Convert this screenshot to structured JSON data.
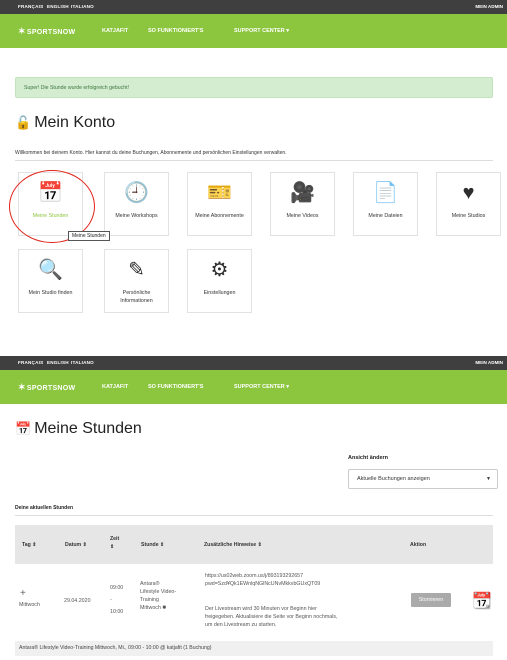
{
  "top_lang": [
    "FRANÇAIS",
    "ENGLISH",
    "ITALIANO"
  ],
  "admin": "MEIN ADMIN",
  "brand": "SPORTSNOW",
  "nav": [
    "KATJAFIT",
    "SO FUNKTIONIERT'S",
    "SUPPORT CENTER ▾"
  ],
  "colors": {
    "accent_green": "#8cc63f",
    "dark_bar": "#3f3f3f",
    "highlight_red": "#e2231a"
  },
  "account": {
    "success_message": "Super! Die Stunde wurde erfolgreich gebucht!",
    "title": "Mein Konto",
    "welcome": "Willkommen bei deinem Konto. Hier kannst du deine Buchungen, Abonnemente und persönlichen Einstellungen verwalten.",
    "tiles": [
      {
        "label": "Meine Stunden",
        "icon": "calendar-icon"
      },
      {
        "label": "Meine Workshops",
        "icon": "clock-icon"
      },
      {
        "label": "Meine Abonnemente",
        "icon": "ticket-icon"
      },
      {
        "label": "Meine Videos",
        "icon": "video-camera-icon"
      },
      {
        "label": "Meine Dateien",
        "icon": "document-icon"
      },
      {
        "label": "Meine Studios",
        "icon": "heart-icon"
      },
      {
        "label": "Mein Studio finden",
        "icon": "search-icon"
      },
      {
        "label": "Persönliche Informationen",
        "icon": "edit-icon"
      },
      {
        "label": "Einstellungen",
        "icon": "gear-icon"
      }
    ],
    "tooltip": "Meine Stunden"
  },
  "lessons": {
    "title": "Meine Stunden",
    "view_label": "Ansicht ändern",
    "view_value": "Aktuelle Buchungen anzeigen",
    "current_label": "Deine aktuellen Stunden",
    "headers": [
      "Tag ⇕",
      "Datum ⇕",
      "Zeit ⇕",
      "Stunde ⇕",
      "Zusätzliche Hinweise ⇕",
      "Aktion"
    ],
    "row": {
      "day": "Mittwoch",
      "date": "29.04.2020",
      "time_start": "09:00",
      "time_sep": "-",
      "time_end": "10:00",
      "lesson": [
        "Antara®",
        "Lifestyle Video-",
        "Training",
        "Mittwoch"
      ],
      "notes": [
        "https://us02web.zoom.us/j/893193292657",
        "pwd=Szd¥Qk1EWnlqNGlNcUNvMkkvbGUxQT09",
        "",
        "Der Livestream wird 30 Minuten vor Beginn hier",
        "freigegeben. Aktualisiere die Seite vor Beginn nochmals,",
        "um den Livestream zu starten."
      ],
      "action": "Stornieren"
    },
    "footer": "Antara® Lifestyle Video-Training Mittwoch, Mi., 09:00 - 10:00 @ katjafit (1 Buchung)"
  }
}
